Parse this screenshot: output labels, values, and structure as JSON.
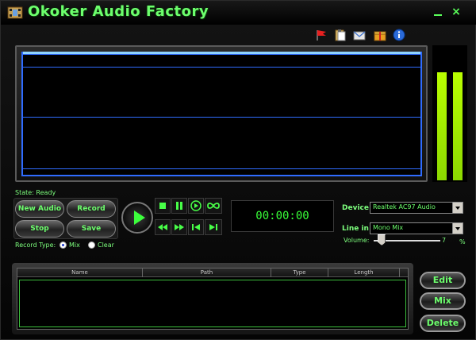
{
  "app": {
    "title": "Okoker Audio Factory",
    "accent_color": "#6dff6d",
    "waveform_color": "#2f6cff",
    "meter_color": "#baff00"
  },
  "window_controls": {
    "minimize_icon": "minimize-icon",
    "close_label": "×"
  },
  "toolbar": {
    "icons": [
      "flag-icon",
      "clipboard-icon",
      "mail-icon",
      "gift-icon",
      "info-icon"
    ]
  },
  "status": {
    "state_text": "State: Ready"
  },
  "record_panel": {
    "new_audio_label": "New Audio",
    "record_label": "Record",
    "stop_label": "Stop",
    "save_label": "Save"
  },
  "record_type": {
    "label": "Record Type:",
    "options": [
      {
        "label": "Mix",
        "selected": true
      },
      {
        "label": "Clear",
        "selected": false
      }
    ]
  },
  "transport": {
    "play_icon": "play-icon",
    "buttons": [
      "stop-icon",
      "pause-icon",
      "play-circle-icon",
      "loop-icon",
      "rewind-icon",
      "fast-forward-icon",
      "skip-back-icon",
      "skip-forward-icon"
    ]
  },
  "timer": {
    "value": "00:00:00"
  },
  "settings": {
    "device_label": "Device:",
    "device_value": "Realtek AC97 Audio",
    "line_in_label": "Line in:",
    "line_in_value": "Mono Mix",
    "volume_label": "Volume:",
    "volume_value": "7",
    "volume_unit": "%",
    "volume_level": 0.07
  },
  "file_list": {
    "columns": [
      "Name",
      "Path",
      "Type",
      "Length"
    ]
  },
  "side_buttons": {
    "edit_label": "Edit",
    "mix_label": "Mix",
    "delete_label": "Delete"
  }
}
